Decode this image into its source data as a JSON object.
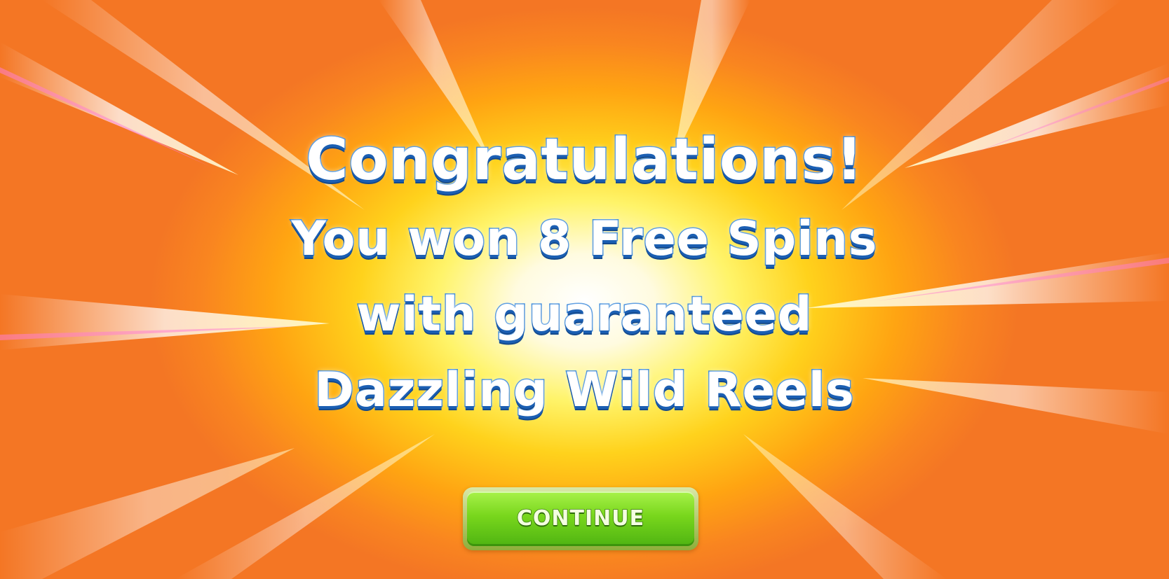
{
  "popup": {
    "title": "Congratulations!",
    "line_2": "You won 8 Free Spins",
    "line_3": "with guaranteed",
    "line_4": "Dazzling Wild Reels"
  },
  "buttons": {
    "continue_label": "CONTINUE"
  },
  "colors": {
    "background_outer": "#f47624",
    "background_glow": "#fff46a",
    "text_fill": "#ffffff",
    "text_outline": "#2a7fd8",
    "button_green": "#78d61c"
  }
}
